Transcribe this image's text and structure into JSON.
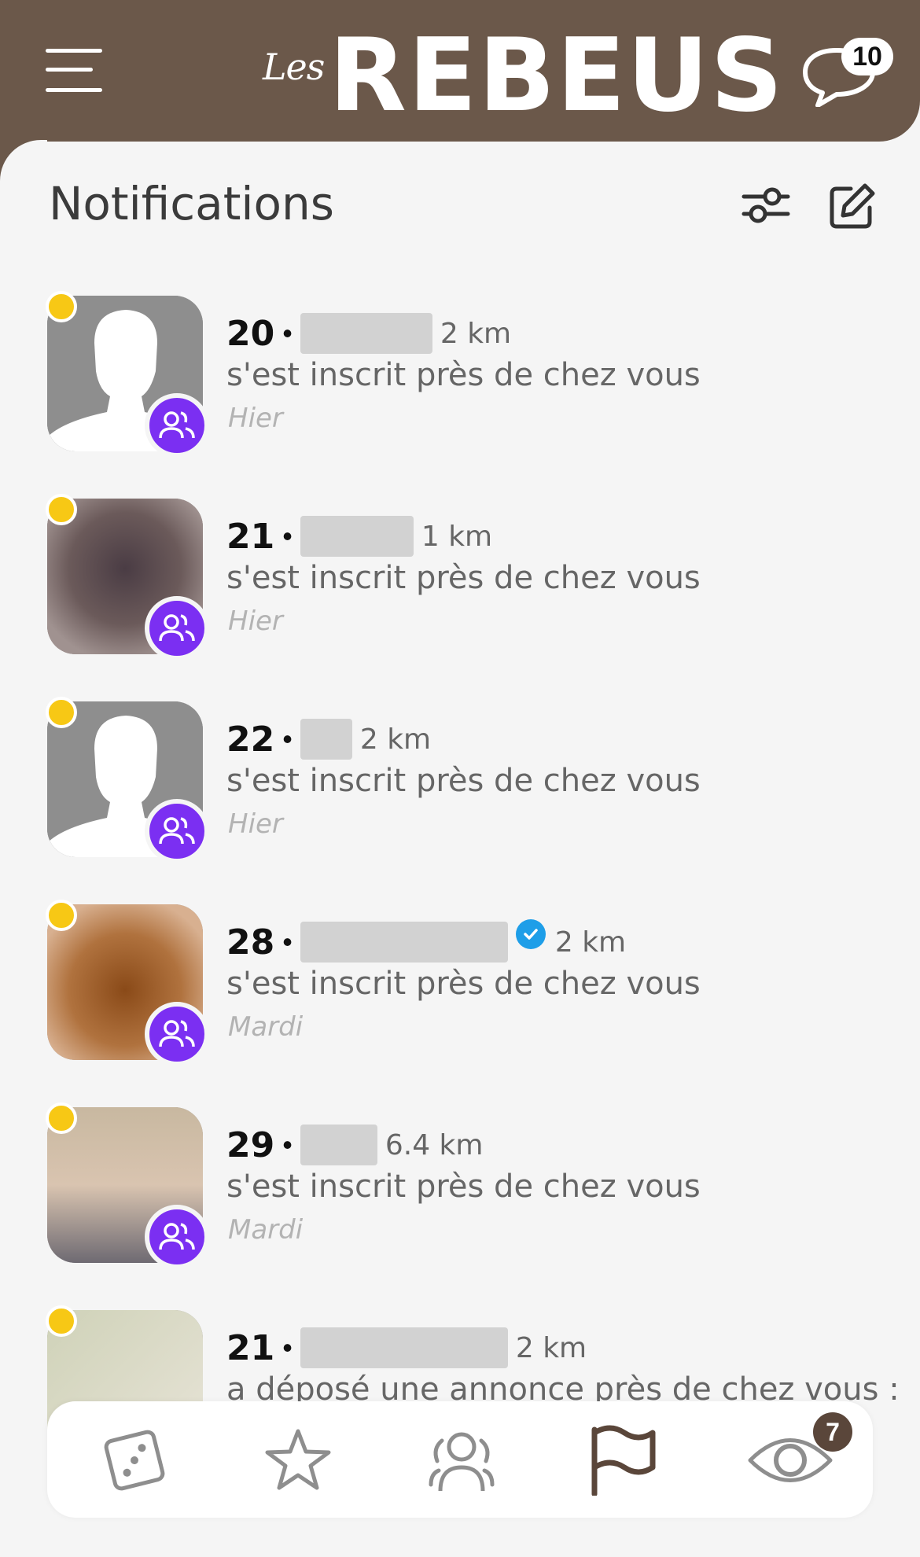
{
  "header": {
    "logo_small": "Les",
    "logo_big": "REBEUS",
    "chat_badge": "10"
  },
  "page": {
    "title": "Notifications"
  },
  "notifications": [
    {
      "age": "20",
      "distance": "2 km",
      "message": "s'est inscrit près de chez vous",
      "when": "Hier",
      "verified": false
    },
    {
      "age": "21",
      "distance": "1 km",
      "message": "s'est inscrit près de chez vous",
      "when": "Hier",
      "verified": false
    },
    {
      "age": "22",
      "distance": "2 km",
      "message": "s'est inscrit près de chez vous",
      "when": "Hier",
      "verified": false
    },
    {
      "age": "28",
      "distance": "2 km",
      "message": "s'est inscrit près de chez vous",
      "when": "Mardi",
      "verified": true
    },
    {
      "age": "29",
      "distance": "6.4 km",
      "message": "s'est inscrit près de chez vous",
      "when": "Mardi",
      "verified": false
    },
    {
      "age": "21",
      "distance": "2 km",
      "message": "a déposé une annonce près de chez vous :",
      "when": "",
      "verified": false
    }
  ],
  "bottom_nav": {
    "items": [
      "dice-icon",
      "star-icon",
      "people-icon",
      "flag-icon",
      "eye-icon"
    ],
    "active": "flag-icon",
    "eye_badge": "7"
  },
  "colors": {
    "header_bg": "#6b584a",
    "online_dot": "#f7c815",
    "group_badge": "#7b2ff2",
    "verified": "#1e9ee8"
  }
}
